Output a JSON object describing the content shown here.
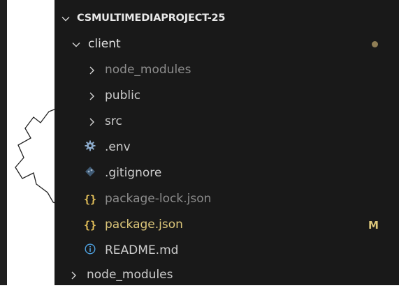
{
  "explorer": {
    "project_title": "CSMULTIMEDIAPROJECT-25",
    "items": [
      {
        "label": "client",
        "type": "folder",
        "expanded": true,
        "badge": "dot"
      },
      {
        "label": "node_modules",
        "type": "folder",
        "expanded": false
      },
      {
        "label": "public",
        "type": "folder",
        "expanded": false
      },
      {
        "label": "src",
        "type": "folder",
        "expanded": false
      },
      {
        "label": ".env",
        "type": "file",
        "icon": "gear-icon"
      },
      {
        "label": ".gitignore",
        "type": "file",
        "icon": "git-icon"
      },
      {
        "label": "package-lock.json",
        "type": "file",
        "icon": "json-icon"
      },
      {
        "label": "package.json",
        "type": "file",
        "icon": "json-icon",
        "status": "M"
      },
      {
        "label": "README.md",
        "type": "file",
        "icon": "info-icon"
      },
      {
        "label": "node_modules",
        "type": "folder",
        "expanded": false
      }
    ],
    "json_glyph": "{}",
    "colors": {
      "background": "#191919",
      "text": "#cccccc",
      "ignored_text": "#8c8c8c",
      "modified": "#dcc67a",
      "json_icon": "#e5c15a",
      "info_icon": "#4fa3e3",
      "gear_icon": "#8aa9c9"
    }
  }
}
